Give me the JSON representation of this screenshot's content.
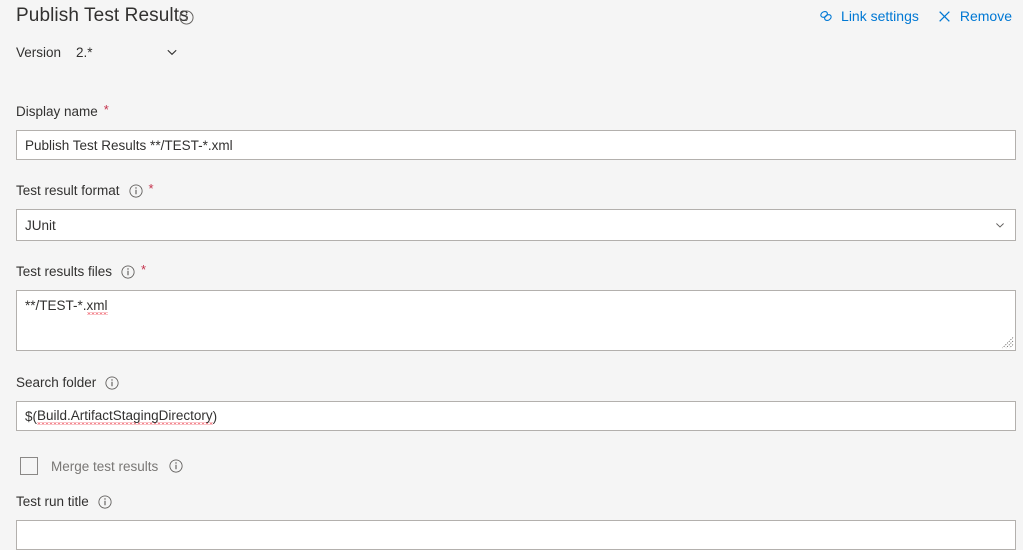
{
  "header": {
    "title": "Publish Test Results",
    "title_info_icon": "info-icon",
    "actions": [
      {
        "label": "Link settings",
        "icon": "link-icon"
      },
      {
        "label": "Remove",
        "icon": "close-icon"
      }
    ]
  },
  "version": {
    "label": "Version",
    "value": "2.*",
    "chevron_icon": "chevron-down-icon"
  },
  "fields": {
    "display_name": {
      "label": "Display name",
      "required": "*",
      "value": "Publish Test Results **/TEST-*.xml"
    },
    "test_result_format": {
      "label": "Test result format",
      "required": "*",
      "info_icon": "info-icon",
      "value": "JUnit",
      "chevron_icon": "chevron-down-icon"
    },
    "test_results_files": {
      "label": "Test results files",
      "required": "*",
      "info_icon": "info-icon",
      "value_prefix": "**/TEST-*.",
      "value_misspelled": "xml"
    },
    "search_folder": {
      "label": "Search folder",
      "info_icon": "info-icon",
      "value_prefix": "$(",
      "value_misspelled": "Build.ArtifactStagingDirectory",
      "value_suffix": ")"
    },
    "merge_test_results": {
      "label": "Merge test results",
      "info_icon": "info-icon",
      "checked": false
    },
    "test_run_title": {
      "label": "Test run title",
      "info_icon": "info-icon",
      "value": "",
      "placeholder": ""
    }
  },
  "colors": {
    "accent": "#0078d4",
    "required": "#c4314b",
    "page_bg": "#f5f5f5",
    "input_bg": "#ffffff",
    "border": "#b3b0ad",
    "text": "#323130",
    "muted_text": "#797775",
    "spellcheck": "#e81123"
  }
}
